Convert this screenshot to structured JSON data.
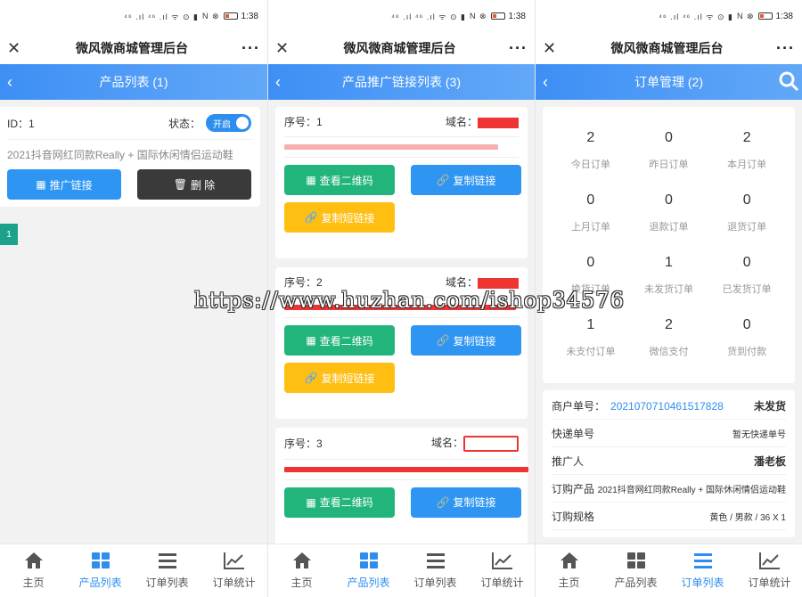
{
  "status": {
    "time": "1:38",
    "signal": "⁴⁶ .ıl ⁴⁶ .ıl ᯤ ⊙ ▮",
    "icons": "N ⊗"
  },
  "app_title": "微风微商城管理后台",
  "panels": {
    "products": {
      "nav_title": "产品列表 (1)",
      "card": {
        "id_label": "ID：1",
        "status_label": "状态：",
        "toggle_label": "开启",
        "product_name": "2021抖音网红同款Really + 国际休闲情侣运动鞋",
        "promo_button": "推广链接",
        "delete_button": "删 除"
      },
      "page": "1"
    },
    "links": {
      "nav_title": "产品推广链接列表 (3)",
      "items": [
        {
          "seq": "序号：1",
          "domain_label": "域名："
        },
        {
          "seq": "序号：2",
          "domain_label": "域名："
        },
        {
          "seq": "序号：3",
          "domain_label": "域名："
        }
      ],
      "qr_button": "查看二维码",
      "copy_button": "复制链接",
      "short_button": "复制短链接"
    },
    "orders": {
      "nav_title": "订单管理 (2)",
      "stats": [
        {
          "num": "2",
          "label": "今日订单"
        },
        {
          "num": "0",
          "label": "昨日订单"
        },
        {
          "num": "2",
          "label": "本月订单"
        },
        {
          "num": "0",
          "label": "上月订单"
        },
        {
          "num": "0",
          "label": "退款订单"
        },
        {
          "num": "0",
          "label": "退货订单"
        },
        {
          "num": "0",
          "label": "换货订单"
        },
        {
          "num": "1",
          "label": "未发货订单"
        },
        {
          "num": "0",
          "label": "已发货订单"
        },
        {
          "num": "1",
          "label": "未支付订单"
        },
        {
          "num": "2",
          "label": "微信支付"
        },
        {
          "num": "0",
          "label": "货到付款"
        }
      ],
      "detail": {
        "merchant_label": "商户单号：",
        "merchant_no": "2021070710461517828",
        "status": "未发货",
        "express_label": "快递单号",
        "express_value": "暂无快递单号",
        "promoter_label": "推广人",
        "promoter_value": "潘老板",
        "product_label": "订购产品",
        "product_value": "2021抖音网红同款Really + 国际休闲情侣运动鞋",
        "spec_label": "订购规格",
        "spec_value": "黄色 / 男款 / 36 X 1"
      }
    }
  },
  "tabs": [
    {
      "label": "主页",
      "icon": "home-icon"
    },
    {
      "label": "产品列表",
      "icon": "grid-icon"
    },
    {
      "label": "订单列表",
      "icon": "list-icon"
    },
    {
      "label": "订单统计",
      "icon": "chart-icon"
    }
  ],
  "watermark": "https://www.huzhan.com/ishop34576",
  "colors": {
    "accent": "#2e8ef0",
    "green": "#21b57b",
    "yellow": "#ffbe12",
    "redact": "#ef3434"
  }
}
